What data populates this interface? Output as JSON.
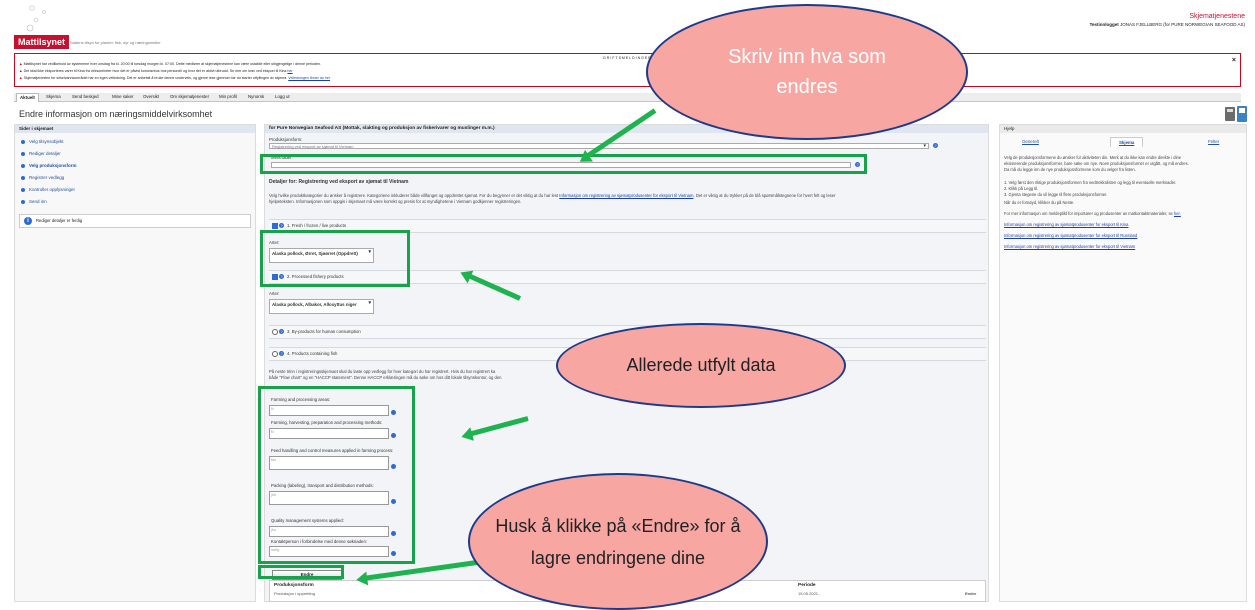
{
  "header": {
    "logo": "Mattilsynet",
    "tagline": "Statens tilsyn for planter, fisk, dyr og næringsmidler",
    "service_name": "Skjematjenestene",
    "login_prefix": "Testinnlogget",
    "login_user": "JONAS FJELLBERG (for PURE NORWEGIAN SEAFOOD AS)"
  },
  "notice": {
    "title": "DRIFTSMELDINGER",
    "lines": [
      {
        "text": "Mattilsynet har vedlikehold av systemene hver onsdag fra kl. 20:00 til torsdag morgen kl. 07:00. Dette medfører at skjematjenestene kan være ustabile eller utilgjengelige i denne perioden.",
        "link": ""
      },
      {
        "text": "Det skal ikke eksporteres varer til Kina fra virksomheter hvor det er påvist koronavirus hos personell og hvor det er aktivt utbrudd. Se mer om krav ved eksport til Kina",
        "link": "her"
      },
      {
        "text": "Skjematjenesten for sirkelvannsområdet har en egen veiledning. Det er anbefalt å bruke denne underveis, og gjerne lese gjennom før du starter utfyllingen av skjema.",
        "link": "Veiledningen finner du her"
      }
    ]
  },
  "nav": {
    "tabs": [
      "Aktuelt",
      "Skjema",
      "Send beskjed",
      "Mine saker",
      "Oversikt",
      "Om skjematjenester",
      "Min profil",
      "Nynorsk",
      "Logg ut"
    ]
  },
  "page": {
    "title": "Endre informasjon om næringsmiddelvirksomhet"
  },
  "left": {
    "heading": "Sider i skjemaet",
    "steps": [
      "Velg tilsynsobjekt",
      "Rediger detaljer",
      "Velg produksjonsform",
      "Registrer vedlegg",
      "Kontroller opplysninger",
      "Send inn"
    ],
    "info": "Rediger detaljer er ferdig"
  },
  "center": {
    "heading": "for Pure Norwegian Seafood AS (Mottak, slakting og produksjon av fiskerivarer og muslinger m.m.)",
    "produksjonsform_label": "Produksjonsform:",
    "produksjonsform_value": "Registrering ved eksport av sjømat til Vietnam",
    "merknader_label": "Merknader:",
    "details_title": "Detaljer for: Registrering ved eksport av sjømat til Vietnam",
    "intro": "Velg hvilke produktkategorier du ønsker å registrere. Kategoriene inkluderer både villfanget og oppdrettet sjømat. For du begynner er det viktig at du har lest",
    "intro_link": "Informasjon om registrering av sjømatprodusenter for eksport til Vietnam",
    "intro_rest": ". Det er viktig at du trykker på de blå spørsmålstegnene for hvert felt og leser",
    "intro_line2": "hjelpeteksten. Informasjonen som oppgis i skjemaet må være korrekt og presis for at myndighetene i Vietnam godkjenner registreringen.",
    "categories": [
      {
        "label": "1. Fresh / frozen / live products",
        "checked": true
      },
      {
        "label": "2. Processed fishery products",
        "checked": true
      },
      {
        "label": "3. By-products for human consumption",
        "checked": false
      },
      {
        "label": "4. Products containing fish",
        "checked": false
      }
    ],
    "arter_label": "Arter:",
    "arter1": "Alaska pollock, Ørret, Sjøørret (Oppdrett)",
    "arter2": "Alaska pollock, Albakor, Alloxyttus niger",
    "bottom_text_a": "På neste trinn i registreringsskjemaet skal du laste opp vedlegg for hver kategori du har registrert. Hvis du har registrert ka",
    "bottom_text_b": "oduktkategori. Hvis du har registrert kategori 2 skal du laste opp",
    "bottom_text_c": "både \"Flow chart\" og en \"HACCP statement\". Denne HACCP erklæringen må du søke om hos ditt lokale tilsynskontor, og den",
    "fields": [
      {
        "label": "Farming and processing areas:",
        "value": "N"
      },
      {
        "label": "Farming, harvesting, preparation and processing methods:",
        "value": "N"
      },
      {
        "label": "Feed handling and control measures applied in farming process:",
        "value": "fisr"
      },
      {
        "label": "Packing (labeling), transport and distribution methods:",
        "value": "jhh"
      },
      {
        "label": "Quality management systems applied:",
        "value": "jho"
      },
      {
        "label": "Kontaktperson i forbindelse med denne søknaden:",
        "value": "mrfty"
      }
    ],
    "endre_button": "Endre",
    "table_header_a": "Produksjonsform",
    "table_header_b": "Periode",
    "table_row_a": "Produksjon i oppretting",
    "table_row_b": "15.05.2021 -",
    "table_row_c": "Endre"
  },
  "right": {
    "heading": "Hjelp",
    "tabs": [
      "Generelt",
      "Skjema",
      "Felter"
    ],
    "lines": [
      "Velg de produksjonsformene du ønsker for aktiviteten din. Merk at du ikke kan endre direkte i dine",
      "eksisterende produksjonsformer, bare søke om nye. Noen produksjonsformer er utgått, og må endres.",
      "Da må du legge inn de nye produksjonsformene som du velger fra listen.",
      "",
      "1. Velg først den riktige produksjonsformen fra nedtrekkslisten og legg til eventuelle merknader.",
      "2. Klikk på Legg til.",
      "3. Gjenta stegene du vil legge til flere produksjonsformer.",
      "Når du er fornøyd, klikker du på Neste."
    ],
    "more_prefix": "For mer informasjon om meldeplikt for importører og produsenter av matkontaktmaterialer, se",
    "more_link": "her.",
    "links": [
      "Informasjon om registrering av sjømatprodusenter for eksport til Kina",
      "Informasjon om registrering av sjømatprodusenter for eksport til Russland",
      "Informasjon om registrering av sjømatprodusenter for eksport til Vietnam"
    ]
  },
  "annotations": {
    "top_bubble": "Skriv inn hva som endres",
    "mid_bubble": "Allerede utfylt data",
    "bottom_bubble": "Husk å klikke på «Endre» for å lagre endringene dine"
  }
}
